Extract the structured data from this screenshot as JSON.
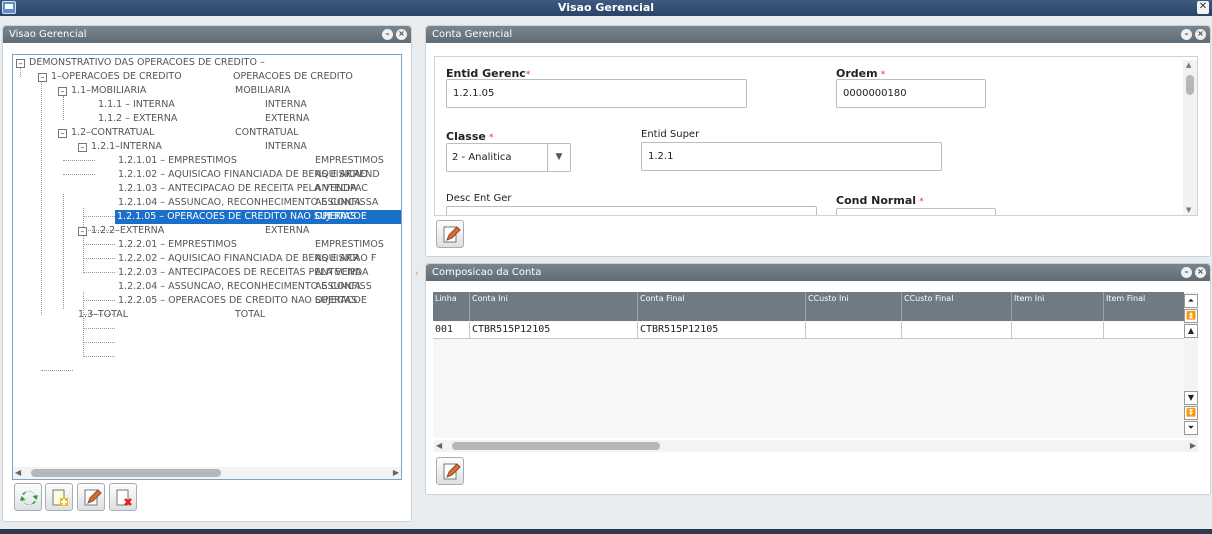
{
  "window": {
    "title": "Visao Gerencial"
  },
  "left_panel": {
    "title": "Visao Gerencial"
  },
  "tree": {
    "root": "DEMONSTRATIVO DAS OPERACOES DE CREDITO –",
    "nodes": [
      {
        "label": "1–OPERACOES DE CREDITO",
        "desc": "OPERACOES DE CREDITO",
        "level": 1
      },
      {
        "label": "1.1–MOBILIARIA",
        "desc": "MOBILIARIA",
        "level": 2
      },
      {
        "label": "1.1.1 – INTERNA",
        "desc": "INTERNA",
        "level": 3
      },
      {
        "label": "1.1.2 – EXTERNA",
        "desc": "EXTERNA",
        "level": 3
      },
      {
        "label": "1.2–CONTRATUAL",
        "desc": "CONTRATUAL",
        "level": 2
      },
      {
        "label": "1.2.1–INTERNA",
        "desc": "INTERNA",
        "level": 3
      },
      {
        "label": "1.2.1.01 – EMPRESTIMOS",
        "desc": "EMPRESTIMOS",
        "level": 4
      },
      {
        "label": "1.2.1.02 – AQUISICAO FINANCIADA DE BENS E ARREND",
        "desc": "AQUISICAO",
        "level": 4
      },
      {
        "label": "1.2.1.03 – ANTECIPACAO DE RECEITA PELA VENDA",
        "desc": "ANTECIPAC",
        "level": 4
      },
      {
        "label": "1.2.1.04 – ASSUNCAO, RECONHECIMENTO E CONFISSA",
        "desc": "ASSUNCA",
        "level": 4
      },
      {
        "label": "1.2.1.05 – OPERACOES DE CREDITO NAO SUJEITAS",
        "desc": "OPERACOE",
        "level": 4,
        "selected": true
      },
      {
        "label": "1.2.2–EXTERNA",
        "desc": "EXTERNA",
        "level": 3
      },
      {
        "label": "1.2.2.01 – EMPRESTIMOS",
        "desc": "EMPRESTIMOS",
        "level": 4
      },
      {
        "label": "1.2.2.02 – AQUISICAO FINANCIADA DE BENS E ARR",
        "desc": "AQUISICAO F",
        "level": 4
      },
      {
        "label": "1.2.2.03 – ANTECIPACOES DE RECEITAS PELA VENDA",
        "desc": "ANTECIPA",
        "level": 4
      },
      {
        "label": "1.2.2.04 – ASSUNCAO, RECONHECIMENTO E CONFISS",
        "desc": "ASSUNCA",
        "level": 4
      },
      {
        "label": "1.2.2.05 – OPERACOES DE CREDITO NAO SUJEITAS",
        "desc": "OPERACOE",
        "level": 4
      },
      {
        "label": "1.3–TOTAL",
        "desc": "TOTAL",
        "level": 2
      }
    ]
  },
  "conta": {
    "title": "Conta Gerencial",
    "entid_gerenc_label": "Entid Gerenc",
    "entid_gerenc_value": "1.2.1.05",
    "ordem_label": "Ordem",
    "ordem_value": "0000000180",
    "classe_label": "Classe",
    "classe_value": "2 - Analitica",
    "entid_super_label": "Entid Super",
    "entid_super_value": "1.2.1",
    "desc_label": "Desc Ent Ger",
    "cond_label": "Cond Normal",
    "req_mark": "*"
  },
  "composicao": {
    "title": "Composicao da Conta",
    "columns": [
      "Linha",
      "Conta Ini",
      "Conta Final",
      "CCusto Ini",
      "CCusto Final",
      "Item Ini",
      "Item Final"
    ],
    "rows": [
      [
        "001",
        "CTBR515P12105",
        "CTBR515P12105",
        "",
        "",
        "",
        ""
      ]
    ]
  }
}
